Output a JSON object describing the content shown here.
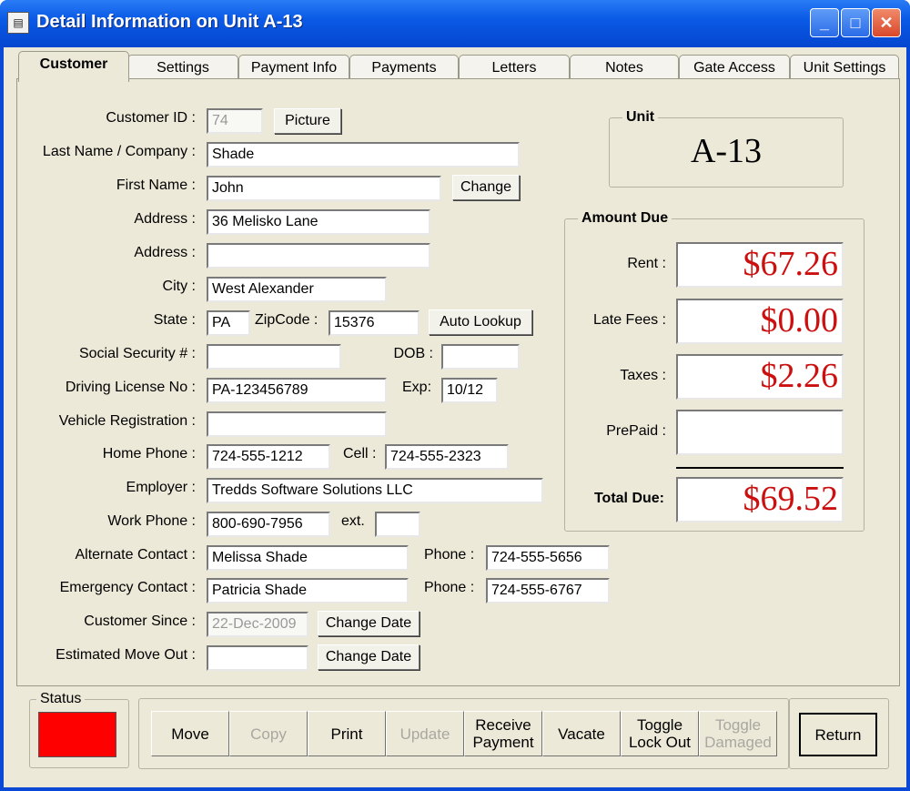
{
  "window": {
    "title": "Detail Information on Unit A-13",
    "min_label": "_",
    "max_label": "□",
    "close_label": "✕"
  },
  "tabs": [
    "Customer",
    "Settings",
    "Payment Info",
    "Payments",
    "Letters",
    "Notes",
    "Gate Access",
    "Unit Settings"
  ],
  "form": {
    "customer_id": {
      "label": "Customer ID :",
      "value": "74"
    },
    "picture_button": "Picture",
    "last_name": {
      "label": "Last Name / Company :",
      "value": "Shade"
    },
    "first_name": {
      "label": "First Name :",
      "value": "John"
    },
    "change_button": "Change",
    "address1": {
      "label": "Address :",
      "value": "36 Melisko Lane"
    },
    "address2": {
      "label": "Address :",
      "value": ""
    },
    "city": {
      "label": "City :",
      "value": "West Alexander"
    },
    "state": {
      "label": "State :",
      "value": "PA"
    },
    "zip": {
      "label": "ZipCode :",
      "value": "15376"
    },
    "auto_lookup_button": "Auto Lookup",
    "ssn": {
      "label": "Social Security # :",
      "value": ""
    },
    "dob": {
      "label": "DOB :",
      "value": ""
    },
    "license": {
      "label": "Driving License No :",
      "value": "PA-123456789"
    },
    "exp": {
      "label": "Exp:",
      "value": "10/12"
    },
    "vehicle": {
      "label": "Vehicle Registration :",
      "value": ""
    },
    "home_phone": {
      "label": "Home Phone :",
      "value": "724-555-1212"
    },
    "cell": {
      "label": "Cell :",
      "value": "724-555-2323"
    },
    "employer": {
      "label": "Employer :",
      "value": "Tredds Software Solutions LLC"
    },
    "work_phone": {
      "label": "Work Phone :",
      "value": "800-690-7956"
    },
    "ext": {
      "label": "ext.",
      "value": ""
    },
    "alt_contact": {
      "label": "Alternate Contact :",
      "value": "Melissa Shade"
    },
    "alt_phone": {
      "label": "Phone :",
      "value": "724-555-5656"
    },
    "emerg_contact": {
      "label": "Emergency Contact :",
      "value": "Patricia Shade"
    },
    "emerg_phone": {
      "label": "Phone :",
      "value": "724-555-6767"
    },
    "customer_since": {
      "label": "Customer Since :",
      "value": "22-Dec-2009"
    },
    "move_out": {
      "label": "Estimated Move Out :",
      "value": ""
    },
    "change_date_button": "Change Date"
  },
  "unit": {
    "title": "Unit",
    "value": "A-13"
  },
  "amount_due": {
    "title": "Amount Due",
    "rent": {
      "label": "Rent :",
      "value": "$67.26"
    },
    "late_fees": {
      "label": "Late Fees :",
      "value": "$0.00"
    },
    "taxes": {
      "label": "Taxes :",
      "value": "$2.26"
    },
    "prepaid": {
      "label": "PrePaid :",
      "value": ""
    },
    "total": {
      "label": "Total Due:",
      "value": "$69.52"
    }
  },
  "status": {
    "title": "Status",
    "color": "#ff0000"
  },
  "actions": {
    "move": "Move",
    "copy": "Copy",
    "print": "Print",
    "update": "Update",
    "receive": "Receive\nPayment",
    "vacate": "Vacate",
    "lockout": "Toggle\nLock Out",
    "damaged": "Toggle\nDamaged",
    "return": "Return"
  },
  "colors": {
    "titlebar": "#0a5ae6",
    "dialog": "#ece9d8",
    "amount_text": "#cc1010"
  }
}
